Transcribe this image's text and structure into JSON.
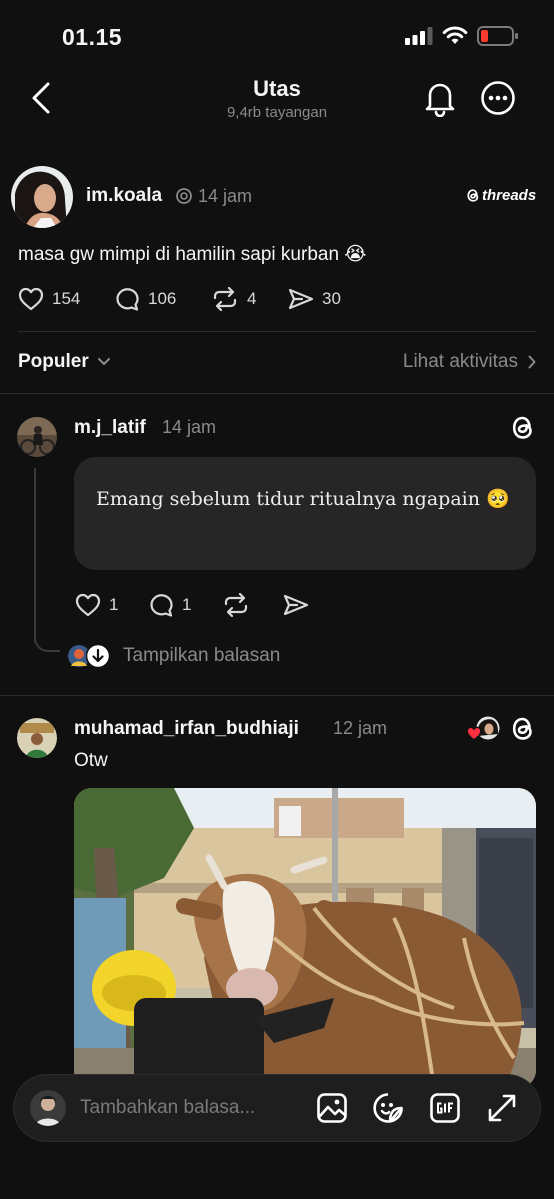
{
  "status_bar": {
    "time": "01.15"
  },
  "header": {
    "title": "Utas",
    "subtitle": "9,4rb tayangan"
  },
  "post": {
    "username": "im.koala",
    "time": "14 jam",
    "brand": "threads",
    "text": "masa gw mimpi di hamilin sapi kurban 😭",
    "likes": "154",
    "replies": "106",
    "reposts": "4",
    "shares": "30"
  },
  "sort": {
    "label": "Populer",
    "activity": "Lihat aktivitas"
  },
  "replies": [
    {
      "username": "m.j_latif",
      "time": "14 jam",
      "text": "Emang sebelum tidur ritualnya ngapain 🥺",
      "likes": "1",
      "replies": "1",
      "show_replies": "Tampilkan balasan"
    },
    {
      "username": "muhamad_irfan_budhiaji",
      "time": "12 jam",
      "text": "Otw"
    }
  ],
  "composer": {
    "placeholder": "Tambahkan balasa..."
  },
  "colors": {
    "background": "#101010",
    "text": "#f3f5f7",
    "muted": "#8a8a8a",
    "like_red": "#ff3040",
    "battery_red": "#ff3b30"
  }
}
